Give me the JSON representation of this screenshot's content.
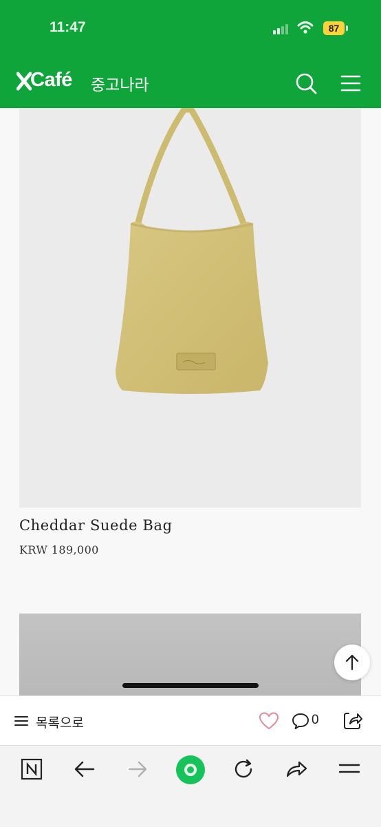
{
  "status": {
    "time": "11:47",
    "battery": "87"
  },
  "header": {
    "logo": "Café",
    "cafe_name": "중고나라"
  },
  "product": {
    "title": "Cheddar Suede Bag",
    "price": "KRW 189,000"
  },
  "action_bar": {
    "list_label": "목록으로",
    "comment_count": "0"
  },
  "colors": {
    "brand_green": "#0fa53a",
    "bag": "#d4c27a"
  }
}
